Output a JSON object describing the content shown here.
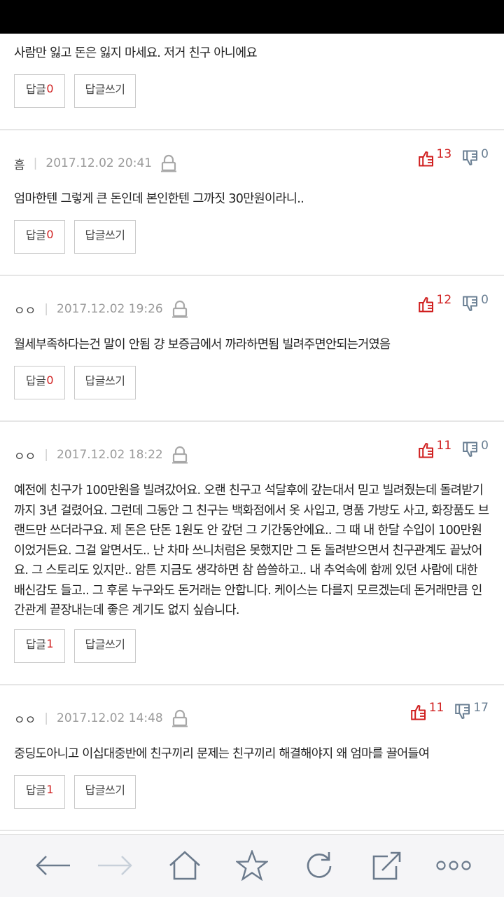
{
  "comments": [
    {
      "author": "",
      "date": "",
      "likes": "",
      "dislikes": "",
      "text": "사람만 잃고 돈은 잃지 마세요. 저거 친구 아니에요",
      "reply_label": "답글",
      "reply_count": "0",
      "write_label": "답글쓰기"
    },
    {
      "author": "흠",
      "date": "2017.12.02 20:41",
      "likes": "13",
      "dislikes": "0",
      "text": "엄마한텐 그렇게 큰 돈인데 본인한텐 그까짓 30만원이라니..",
      "reply_label": "답글",
      "reply_count": "0",
      "write_label": "답글쓰기"
    },
    {
      "author": "ㅇㅇ",
      "date": "2017.12.02 19:26",
      "likes": "12",
      "dislikes": "0",
      "text": "월세부족하다는건 말이 안됨 걍 보증금에서 까라하면됨 빌려주면안되는거였음",
      "reply_label": "답글",
      "reply_count": "0",
      "write_label": "답글쓰기"
    },
    {
      "author": "ㅇㅇ",
      "date": "2017.12.02 18:22",
      "likes": "11",
      "dislikes": "0",
      "text": "예전에 친구가 100만원을 빌려갔어요. 오랜 친구고 석달후에 갚는대서 믿고 빌려줬는데 돌려받기까지 3년 걸렸어요. 그런데 그동안 그 친구는 백화점에서 옷 사입고, 명품 가방도 사고, 화장품도 브랜드만 쓰더라구요. 제 돈은 단돈 1원도 안 갚던 그 기간동안에요.. 그 때 내 한달 수입이 100만원이었거든요. 그걸 알면서도.. 난 차마 쓰니처럼은 못했지만 그 돈 돌려받으면서 친구관계도 끝났어요. 그 스토리도 있지만.. 암튼 지금도 생각하면 참 씁쓸하고.. 내 추억속에 함께 있던 사람에 대한 배신감도 들고.. 그 후론 누구와도 돈거래는 안합니다. 케이스는 다를지 모르겠는데 돈거래만큼 인간관계 끝장내는데 좋은 계기도 없지 싶습니다.",
      "reply_label": "답글",
      "reply_count": "1",
      "write_label": "답글쓰기"
    },
    {
      "author": "ㅇㅇ",
      "date": "2017.12.02 14:48",
      "likes": "11",
      "dislikes": "17",
      "text": "중딩도아니고 이십대중반에 친구끼리 문제는 친구끼리 해결해야지 왜 엄마를 끌어들여",
      "reply_label": "답글",
      "reply_count": "1",
      "write_label": "답글쓰기"
    }
  ],
  "browser_nav": {
    "icons": [
      "back-icon",
      "forward-icon",
      "home-icon",
      "bookmark-star-icon",
      "refresh-icon",
      "share-icon",
      "more-icon"
    ],
    "forward_enabled": false
  },
  "colors": {
    "like": "#d02020",
    "dislike": "#6a7f93",
    "reply_count": "#d02020",
    "nav_icon": "#6b7a8c",
    "nav_icon_disabled": "#c8d0da"
  }
}
